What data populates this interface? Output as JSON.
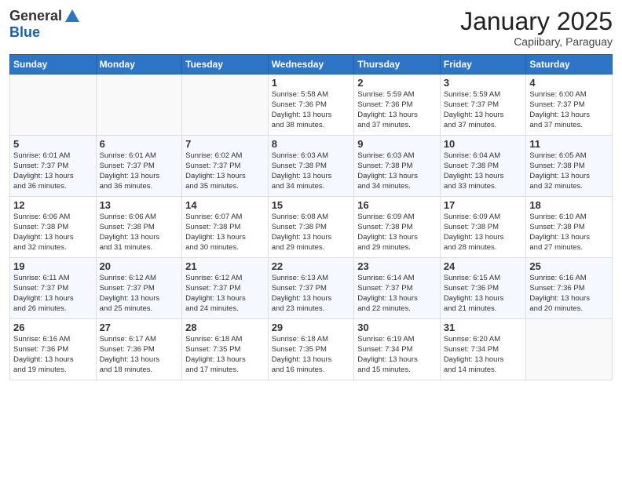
{
  "header": {
    "logo_general": "General",
    "logo_blue": "Blue",
    "month_title": "January 2025",
    "location": "Capiibary, Paraguay"
  },
  "days_of_week": [
    "Sunday",
    "Monday",
    "Tuesday",
    "Wednesday",
    "Thursday",
    "Friday",
    "Saturday"
  ],
  "weeks": [
    [
      {
        "day": "",
        "info": ""
      },
      {
        "day": "",
        "info": ""
      },
      {
        "day": "",
        "info": ""
      },
      {
        "day": "1",
        "info": "Sunrise: 5:58 AM\nSunset: 7:36 PM\nDaylight: 13 hours\nand 38 minutes."
      },
      {
        "day": "2",
        "info": "Sunrise: 5:59 AM\nSunset: 7:36 PM\nDaylight: 13 hours\nand 37 minutes."
      },
      {
        "day": "3",
        "info": "Sunrise: 5:59 AM\nSunset: 7:37 PM\nDaylight: 13 hours\nand 37 minutes."
      },
      {
        "day": "4",
        "info": "Sunrise: 6:00 AM\nSunset: 7:37 PM\nDaylight: 13 hours\nand 37 minutes."
      }
    ],
    [
      {
        "day": "5",
        "info": "Sunrise: 6:01 AM\nSunset: 7:37 PM\nDaylight: 13 hours\nand 36 minutes."
      },
      {
        "day": "6",
        "info": "Sunrise: 6:01 AM\nSunset: 7:37 PM\nDaylight: 13 hours\nand 36 minutes."
      },
      {
        "day": "7",
        "info": "Sunrise: 6:02 AM\nSunset: 7:37 PM\nDaylight: 13 hours\nand 35 minutes."
      },
      {
        "day": "8",
        "info": "Sunrise: 6:03 AM\nSunset: 7:38 PM\nDaylight: 13 hours\nand 34 minutes."
      },
      {
        "day": "9",
        "info": "Sunrise: 6:03 AM\nSunset: 7:38 PM\nDaylight: 13 hours\nand 34 minutes."
      },
      {
        "day": "10",
        "info": "Sunrise: 6:04 AM\nSunset: 7:38 PM\nDaylight: 13 hours\nand 33 minutes."
      },
      {
        "day": "11",
        "info": "Sunrise: 6:05 AM\nSunset: 7:38 PM\nDaylight: 13 hours\nand 32 minutes."
      }
    ],
    [
      {
        "day": "12",
        "info": "Sunrise: 6:06 AM\nSunset: 7:38 PM\nDaylight: 13 hours\nand 32 minutes."
      },
      {
        "day": "13",
        "info": "Sunrise: 6:06 AM\nSunset: 7:38 PM\nDaylight: 13 hours\nand 31 minutes."
      },
      {
        "day": "14",
        "info": "Sunrise: 6:07 AM\nSunset: 7:38 PM\nDaylight: 13 hours\nand 30 minutes."
      },
      {
        "day": "15",
        "info": "Sunrise: 6:08 AM\nSunset: 7:38 PM\nDaylight: 13 hours\nand 29 minutes."
      },
      {
        "day": "16",
        "info": "Sunrise: 6:09 AM\nSunset: 7:38 PM\nDaylight: 13 hours\nand 29 minutes."
      },
      {
        "day": "17",
        "info": "Sunrise: 6:09 AM\nSunset: 7:38 PM\nDaylight: 13 hours\nand 28 minutes."
      },
      {
        "day": "18",
        "info": "Sunrise: 6:10 AM\nSunset: 7:38 PM\nDaylight: 13 hours\nand 27 minutes."
      }
    ],
    [
      {
        "day": "19",
        "info": "Sunrise: 6:11 AM\nSunset: 7:37 PM\nDaylight: 13 hours\nand 26 minutes."
      },
      {
        "day": "20",
        "info": "Sunrise: 6:12 AM\nSunset: 7:37 PM\nDaylight: 13 hours\nand 25 minutes."
      },
      {
        "day": "21",
        "info": "Sunrise: 6:12 AM\nSunset: 7:37 PM\nDaylight: 13 hours\nand 24 minutes."
      },
      {
        "day": "22",
        "info": "Sunrise: 6:13 AM\nSunset: 7:37 PM\nDaylight: 13 hours\nand 23 minutes."
      },
      {
        "day": "23",
        "info": "Sunrise: 6:14 AM\nSunset: 7:37 PM\nDaylight: 13 hours\nand 22 minutes."
      },
      {
        "day": "24",
        "info": "Sunrise: 6:15 AM\nSunset: 7:36 PM\nDaylight: 13 hours\nand 21 minutes."
      },
      {
        "day": "25",
        "info": "Sunrise: 6:16 AM\nSunset: 7:36 PM\nDaylight: 13 hours\nand 20 minutes."
      }
    ],
    [
      {
        "day": "26",
        "info": "Sunrise: 6:16 AM\nSunset: 7:36 PM\nDaylight: 13 hours\nand 19 minutes."
      },
      {
        "day": "27",
        "info": "Sunrise: 6:17 AM\nSunset: 7:36 PM\nDaylight: 13 hours\nand 18 minutes."
      },
      {
        "day": "28",
        "info": "Sunrise: 6:18 AM\nSunset: 7:35 PM\nDaylight: 13 hours\nand 17 minutes."
      },
      {
        "day": "29",
        "info": "Sunrise: 6:18 AM\nSunset: 7:35 PM\nDaylight: 13 hours\nand 16 minutes."
      },
      {
        "day": "30",
        "info": "Sunrise: 6:19 AM\nSunset: 7:34 PM\nDaylight: 13 hours\nand 15 minutes."
      },
      {
        "day": "31",
        "info": "Sunrise: 6:20 AM\nSunset: 7:34 PM\nDaylight: 13 hours\nand 14 minutes."
      },
      {
        "day": "",
        "info": ""
      }
    ]
  ]
}
